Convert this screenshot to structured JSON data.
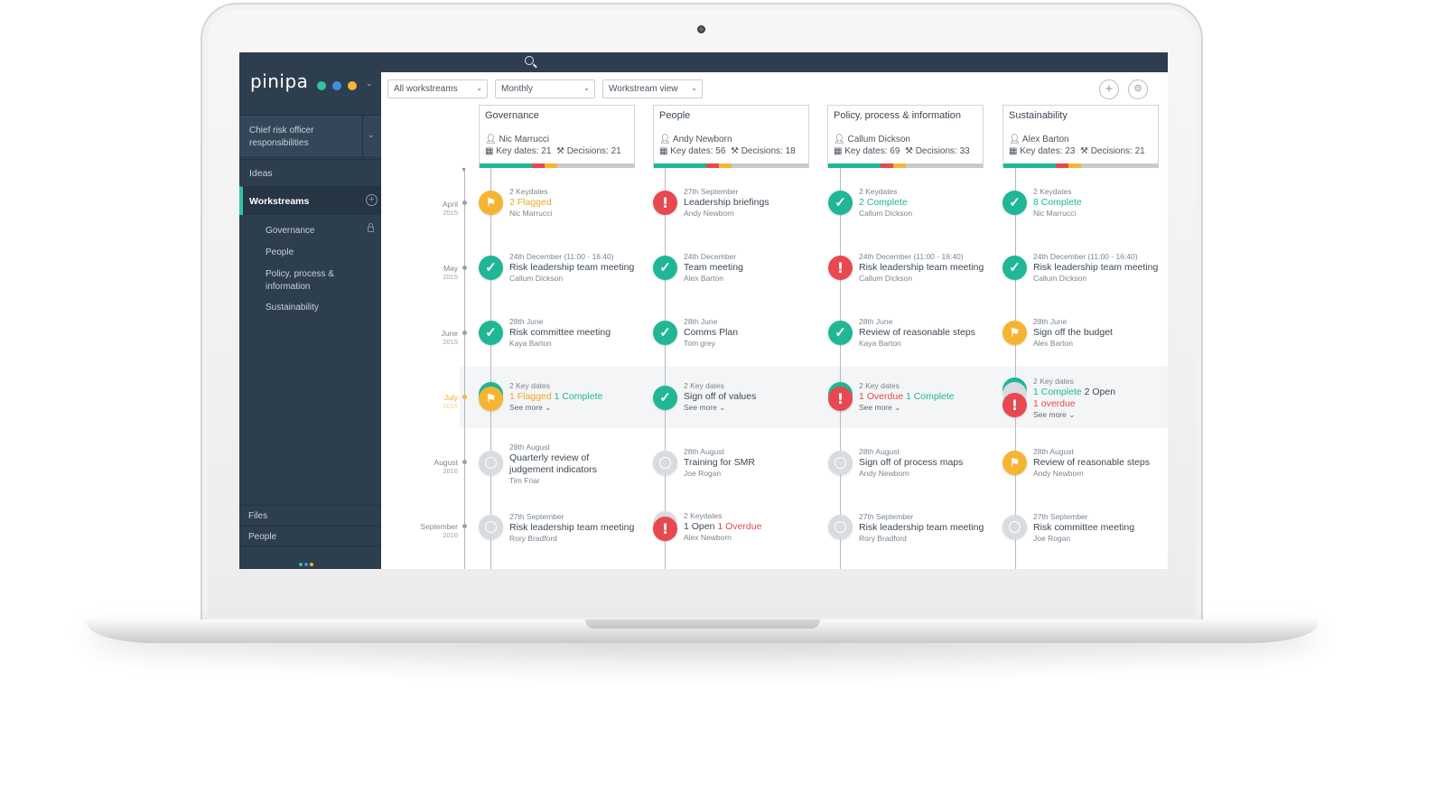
{
  "colors": {
    "sidebar": "#2d3e4f",
    "accent": "#2ec4a0",
    "complete": "#1fb795",
    "overdue": "#e8484f",
    "flagged": "#f5b533",
    "pending": "#d9dcdf"
  },
  "sidebar": {
    "logo": "pinipa",
    "logo_dots": [
      "#2ec4a0",
      "#3f8fe0",
      "#f5b533"
    ],
    "role": "Chief risk officer responsibilities",
    "ideas": "Ideas",
    "workstreams": "Workstreams",
    "sub_items": [
      "Governance",
      "People",
      "Policy, process & information",
      "Sustainability"
    ],
    "files": "Files",
    "people": "People"
  },
  "toolbar": {
    "filter_workstreams": "All workstreams",
    "filter_period": "Monthly",
    "filter_view": "Workstream view"
  },
  "workstreams": [
    {
      "title": "Governance",
      "owner": "Nic Marrucci",
      "key_dates": "Key dates: 21",
      "decisions": "Decisions: 21"
    },
    {
      "title": "People",
      "owner": "Andy Newborn",
      "key_dates": "Key dates: 56",
      "decisions": "Decisions: 18"
    },
    {
      "title": "Policy, process & information",
      "owner": "Callum Dickson",
      "key_dates": "Key dates: 69",
      "decisions": "Decisions: 33"
    },
    {
      "title": "Sustainability",
      "owner": "Alex Barton",
      "key_dates": "Key dates: 23",
      "decisions": "Decisions: 21"
    }
  ],
  "months": [
    {
      "month": "April",
      "year": "2015"
    },
    {
      "month": "May",
      "year": "2015"
    },
    {
      "month": "June",
      "year": "2015"
    },
    {
      "month": "July",
      "year": "2015"
    },
    {
      "month": "August",
      "year": "2016"
    },
    {
      "month": "September",
      "year": "2016"
    }
  ],
  "events": {
    "governance": [
      {
        "status": "flagged",
        "date": "2 Keydates",
        "title": "2 Flagged",
        "person": "Nic Marrucci"
      },
      {
        "status": "complete",
        "date": "24th December (11:00 - 16:40)",
        "title": "Risk leadership team meeting",
        "person": "Callum Dickson"
      },
      {
        "status": "complete",
        "date": "28th June",
        "title": "Risk committee meeting",
        "person": "Kaya Barton"
      },
      {
        "status": "flagged",
        "date": "2 Key dates",
        "flagged": "1 Flagged",
        "complete": "1 Complete",
        "more": "See more ⌄"
      },
      {
        "status": "pending",
        "date": "28th August",
        "title": "Quarterly review of judgement indicators",
        "person": "Tim Friar"
      },
      {
        "status": "pending",
        "date": "27th September",
        "title": "Risk leadership team meeting",
        "person": "Rory Bradford"
      }
    ],
    "people": [
      {
        "status": "overdue",
        "date": "27th September",
        "title": "Leadership briefings",
        "person": "Andy Newborn"
      },
      {
        "status": "complete",
        "date": "24th December",
        "title": "Team meeting",
        "person": "Alex Barton"
      },
      {
        "status": "complete",
        "date": "28th June",
        "title": "Comms Plan",
        "person": "Tom grey"
      },
      {
        "status": "complete",
        "date": "2 Key dates",
        "title": "Sign off of values",
        "more": "See more ⌄"
      },
      {
        "status": "pending",
        "date": "28th August",
        "title": "Training for SMR",
        "person": "Joe Rogan"
      },
      {
        "status": "overdue",
        "date": "2 Keydates",
        "open": "1 Open",
        "overdue": "1 Overdue",
        "person": "Alex Newborn"
      }
    ],
    "policy": [
      {
        "status": "complete",
        "date": "2 Keydates",
        "title": "2 Complete",
        "person": "Callum Dickson"
      },
      {
        "status": "overdue",
        "date": "24th December (11:00 - 16:40)",
        "title": "Risk leadership team meeting",
        "person": "Callum Dickson"
      },
      {
        "status": "complete",
        "date": "28th June",
        "title": "Review of reasonable steps",
        "person": "Kaya Barton"
      },
      {
        "status": "overdue",
        "date": "2 Key dates",
        "overdue": "1 Overdue",
        "complete": "1 Complete",
        "more": "See more ⌄"
      },
      {
        "status": "pending",
        "date": "28th August",
        "title": "Sign off of process maps",
        "person": "Andy Newborn"
      },
      {
        "status": "pending",
        "date": "27th September",
        "title": "Risk leadership team meeting",
        "person": "Rory Bradford"
      }
    ],
    "sustainability": [
      {
        "status": "complete",
        "date": "2 Keydates",
        "title": "8 Complete",
        "person": "Nic Marrucci"
      },
      {
        "status": "complete",
        "date": "24th December (11:00 - 16:40)",
        "title": "Risk leadership team meeting",
        "person": "Callum Dickson"
      },
      {
        "status": "flagged",
        "date": "28th June",
        "title": "Sign off the budget",
        "person": "Alex Barton"
      },
      {
        "status": "overdue",
        "date": "2 Key dates",
        "complete": "1 Complete",
        "open": "2 Open",
        "overdue": "1 overdue",
        "more": "See more ⌄"
      },
      {
        "status": "flagged",
        "date": "28th August",
        "title": "Review of reasonable steps",
        "person": "Andy Newborn"
      },
      {
        "status": "pending",
        "date": "27th September",
        "title": "Risk committee meeting",
        "person": "Joe Rogan"
      }
    ]
  }
}
